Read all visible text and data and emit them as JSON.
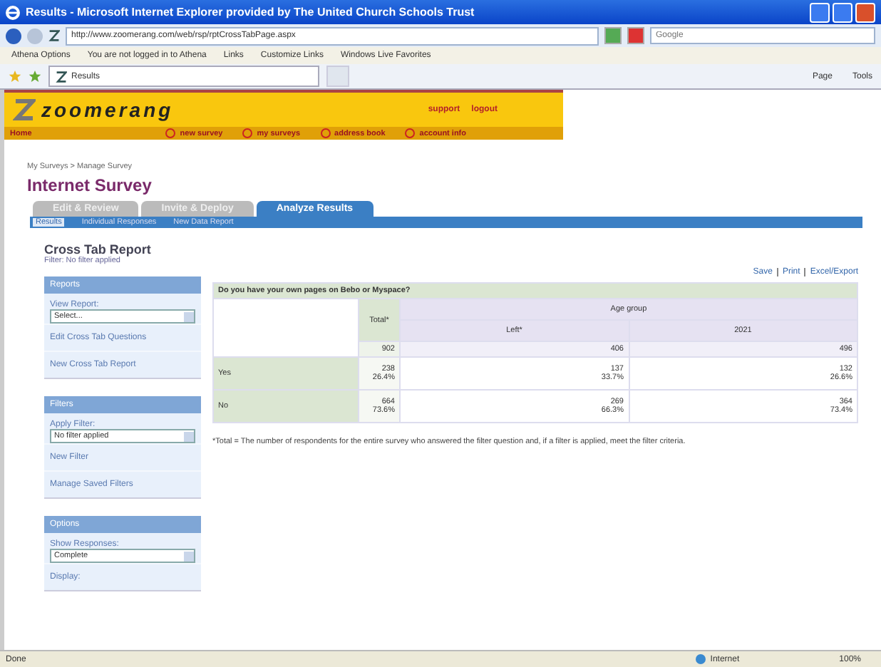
{
  "window": {
    "title": "Results - Microsoft Internet Explorer provided by The United Church Schools Trust"
  },
  "address": {
    "url": "http://www.zoomerang.com/web/rsp/rptCrossTabPage.aspx",
    "search_placeholder": "Google"
  },
  "links_bar": {
    "items": [
      "Athena Options",
      "You are not logged in to Athena",
      "Links",
      "Customize Links",
      "Windows Live Favorites"
    ]
  },
  "browser_tab": {
    "title": "Results"
  },
  "command_bar": [
    "Page",
    "Tools"
  ],
  "site_header": {
    "logo": "zoomerang",
    "top_links": [
      "support",
      "logout"
    ],
    "home": "Home",
    "nav": [
      "new survey",
      "my surveys",
      "address book",
      "account info"
    ]
  },
  "breadcrumb": "My Surveys > Manage Survey",
  "survey_title": "Internet Survey",
  "tabs": [
    {
      "label": "Edit & Review",
      "selected": false
    },
    {
      "label": "Invite & Deploy",
      "selected": false
    },
    {
      "label": "Analyze Results",
      "selected": true
    }
  ],
  "subtabs": [
    {
      "label": "Results",
      "selected": true
    },
    {
      "label": "Individual Responses",
      "selected": false
    },
    {
      "label": "New Data Report",
      "selected": false
    }
  ],
  "report": {
    "title": "Cross Tab Report",
    "filter": "Filter: No filter applied",
    "actions": [
      "Save",
      "Print",
      "Excel/Export"
    ]
  },
  "sidebar": [
    {
      "heading": "Reports",
      "label": "View Report:",
      "select": "Select...",
      "links": [
        "Edit Cross Tab Questions",
        "New Cross Tab Report"
      ]
    },
    {
      "heading": "Filters",
      "label": "Apply Filter:",
      "select": "No filter applied",
      "links": [
        "New Filter",
        "Manage Saved Filters"
      ]
    },
    {
      "heading": "Options",
      "label": "Show Responses:",
      "select": "Complete",
      "links": [
        "Display:"
      ]
    }
  ],
  "table": {
    "question": "Do you have your own pages on Bebo or Myspace?",
    "group": "Age group",
    "columns": [
      "Total*",
      "Left*",
      "2021"
    ],
    "counts": [
      "902",
      "406",
      "496"
    ],
    "rows": [
      {
        "label": "Yes",
        "cells": [
          [
            "238",
            "26.4%"
          ],
          [
            "137",
            "33.7%"
          ],
          [
            "132",
            "26.6%"
          ]
        ]
      },
      {
        "label": "No",
        "cells": [
          [
            "664",
            "73.6%"
          ],
          [
            "269",
            "66.3%"
          ],
          [
            "364",
            "73.4%"
          ]
        ]
      }
    ]
  },
  "footnote": "*Total = The number of respondents for the entire survey who answered the filter question and, if a filter is applied, meet the filter criteria.",
  "status_bar": {
    "text": "Done",
    "zone": "Internet",
    "zoom": "100%"
  }
}
